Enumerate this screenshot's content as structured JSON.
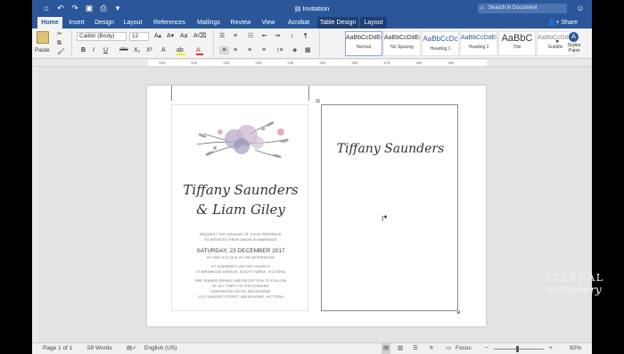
{
  "window": {
    "title": "Invitation"
  },
  "quick_access": {
    "home_icon": "home-icon",
    "undo_icon": "undo-icon",
    "redo_icon": "redo-icon",
    "save_icon": "save-icon",
    "print_icon": "print-icon"
  },
  "search": {
    "placeholder": "Search in Document"
  },
  "tabs": [
    "Home",
    "Insert",
    "Design",
    "Layout",
    "References",
    "Mailings",
    "Review",
    "View",
    "Acrobat",
    "Table Design",
    "Layout"
  ],
  "share_label": "Share",
  "ribbon": {
    "paste_label": "Paste",
    "font_name": "Calibri (Body)",
    "font_size": "12",
    "styles": [
      {
        "sample": "AaBbCcDdEe",
        "name": "Normal"
      },
      {
        "sample": "AaBbCcDdEe",
        "name": "No Spacing"
      },
      {
        "sample": "AaBbCcDc",
        "name": "Heading 1"
      },
      {
        "sample": "AaBbCcDdEe",
        "name": "Heading 2"
      },
      {
        "sample": "AaBbC",
        "name": "Title"
      },
      {
        "sample": "AaBbCcDdEe",
        "name": "Subtitle"
      }
    ],
    "styles_pane_label": "Styles Pane",
    "accent_color": "#2b579a",
    "font_color": "#d32f2f",
    "highlight_color": "#f5e600"
  },
  "ruler": {
    "ticks": [
      "100",
      "110",
      "120",
      "130",
      "140",
      "150",
      "160",
      "170",
      "180",
      "190"
    ]
  },
  "invitation": {
    "name1": "Tiffany Saunders",
    "name2": "& Liam Giley",
    "request1": "REQUEST THE HONOUR OF YOUR PRESENCE",
    "request2": "TO WITNESS THEIR UNION IN MARRIAGE",
    "date": "SATURDAY, 23 DECEMBER 2017",
    "time": "AT ONE O'CLOCK IN THE AFTERNOON",
    "church": "ST. ANDREW'S UNITING CHURCH",
    "church_address": "17 BIRDWOOD AVENUE, SOUTH YARRA, VICTORIA",
    "reception1": "PRE DINNER DRINKS AND RECEPTION TO FOLLOW",
    "reception2": "AT SIX THIRTY IN THE EVENING",
    "venue": "KINGSWOOD HOTEL MELBOURNE",
    "venue_address": "124 FLINDERS STREET, MELBOURNE, VICTORIA"
  },
  "right_card": {
    "name": "Tiffany Saunders"
  },
  "brand": {
    "line1": "ETERNAL",
    "line2": "stationery"
  },
  "status": {
    "page": "Page 1 of 1",
    "words": "59 Words",
    "language": "English (US)",
    "focus": "Focus",
    "zoom": "92%"
  }
}
